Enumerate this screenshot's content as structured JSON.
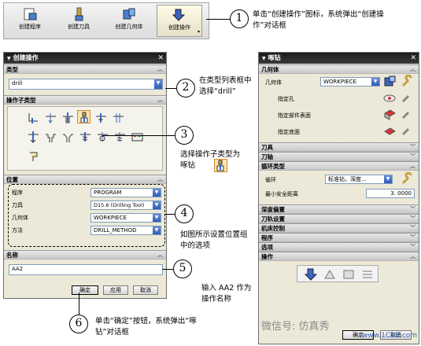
{
  "toolbar": {
    "buttons": [
      {
        "label": "创建程序",
        "icon": "program-icon"
      },
      {
        "label": "创建刀具",
        "icon": "tool-icon"
      },
      {
        "label": "创建几何体",
        "icon": "geometry-icon"
      },
      {
        "label": "创建操作",
        "icon": "operation-icon"
      }
    ]
  },
  "create_dialog": {
    "title": "创建操作",
    "type_section": "类型",
    "type_value": "drill",
    "subtype_section": "操作子类型",
    "location_section": "位置",
    "fields": [
      {
        "label": "程序",
        "value": "PROGRAM"
      },
      {
        "label": "刀具",
        "value": "D15.6 (Drilling Tool)"
      },
      {
        "label": "几何体",
        "value": "WORKPIECE"
      },
      {
        "label": "方法",
        "value": "DRILL_METHOD"
      }
    ],
    "name_section": "名称",
    "name_value": "AA2",
    "ok": "确定",
    "apply": "应用",
    "cancel": "取消"
  },
  "drill_dialog": {
    "title": "啄钻",
    "geometry_section": "几何体",
    "geometry_label": "几何体",
    "geometry_value": "WORKPIECE",
    "specify_hole": "指定孔",
    "specify_part_surface": "指定部件表面",
    "specify_bottom_surface": "指定底面",
    "sections_collapsed_top": [
      "刀具",
      "刀轴"
    ],
    "cycle_section": "循环类型",
    "cycle_label": "循环",
    "cycle_value": "标准钻，深度...",
    "min_clearance_label": "最小安全距离",
    "min_clearance_value": "3. 0000",
    "sections_collapsed_bottom": [
      "深度偏置",
      "刀轨设置",
      "机床控制",
      "程序",
      "选项"
    ],
    "operation_section": "操作",
    "ok": "确定",
    "cancel": "取消"
  },
  "annotations": [
    {
      "num": "1",
      "text": "单击“创建操作”图标，系统弹出“创建操作”对话框"
    },
    {
      "num": "2",
      "text": "在类型列表框中选择“drill”"
    },
    {
      "num": "3",
      "text": "选择操作子类型为啄钻"
    },
    {
      "num": "4",
      "text": "如图所示设置位置组中的选项"
    },
    {
      "num": "5",
      "text": "输入 AA2 作为操作名称"
    },
    {
      "num": "6",
      "text": "单击“确定”按钮，系统弹出“啄钻”对话框"
    }
  ],
  "watermark": {
    "text": "微信号: 仿真秀",
    "site": "www.1CAE.com"
  },
  "colors": {
    "title_bar": "#2a2a2a",
    "dialog_bg": "#ece9d8",
    "selected": "#ffe5b0",
    "dropdown": "#3a66c4"
  }
}
